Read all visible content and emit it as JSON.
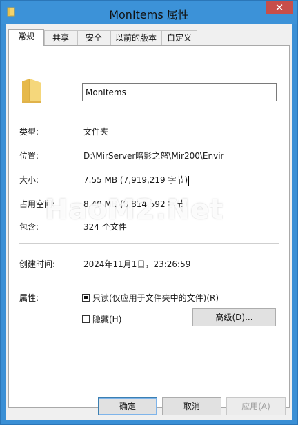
{
  "window": {
    "title": "MonItems 属性",
    "close_glyph": "✕",
    "title_icon": "folder-icon",
    "accent_color": "#3c92d8"
  },
  "tabs": [
    {
      "label": "常规",
      "active": true
    },
    {
      "label": "共享",
      "active": false
    },
    {
      "label": "安全",
      "active": false
    },
    {
      "label": "以前的版本",
      "active": false
    },
    {
      "label": "自定义",
      "active": false
    }
  ],
  "general": {
    "folder_name": "MonItems",
    "type_label": "类型:",
    "type_value": "文件夹",
    "location_label": "位置:",
    "location_value": "D:\\MirServer暗影之怒\\Mir200\\Envir",
    "size_label": "大小:",
    "size_value": "7.55 MB (7,919,219 字节)",
    "size_on_disk_label": "占用空间:",
    "size_on_disk_value": "8.40 MB (8,814,592 字节)",
    "contains_label": "包含:",
    "contains_value": "324 个文件",
    "created_label": "创建时间:",
    "created_value": "2024年11月1日，23:26:59",
    "attributes_label": "属性:",
    "readonly_label": "只读(仅应用于文件夹中的文件)(R)",
    "readonly_checked": true,
    "hidden_label": "隐藏(H)",
    "hidden_checked": false,
    "advanced_button": "高级(D)..."
  },
  "footer": {
    "ok": "确定",
    "cancel": "取消",
    "apply": "应用(A)"
  },
  "watermark": "HaoM2.Net"
}
